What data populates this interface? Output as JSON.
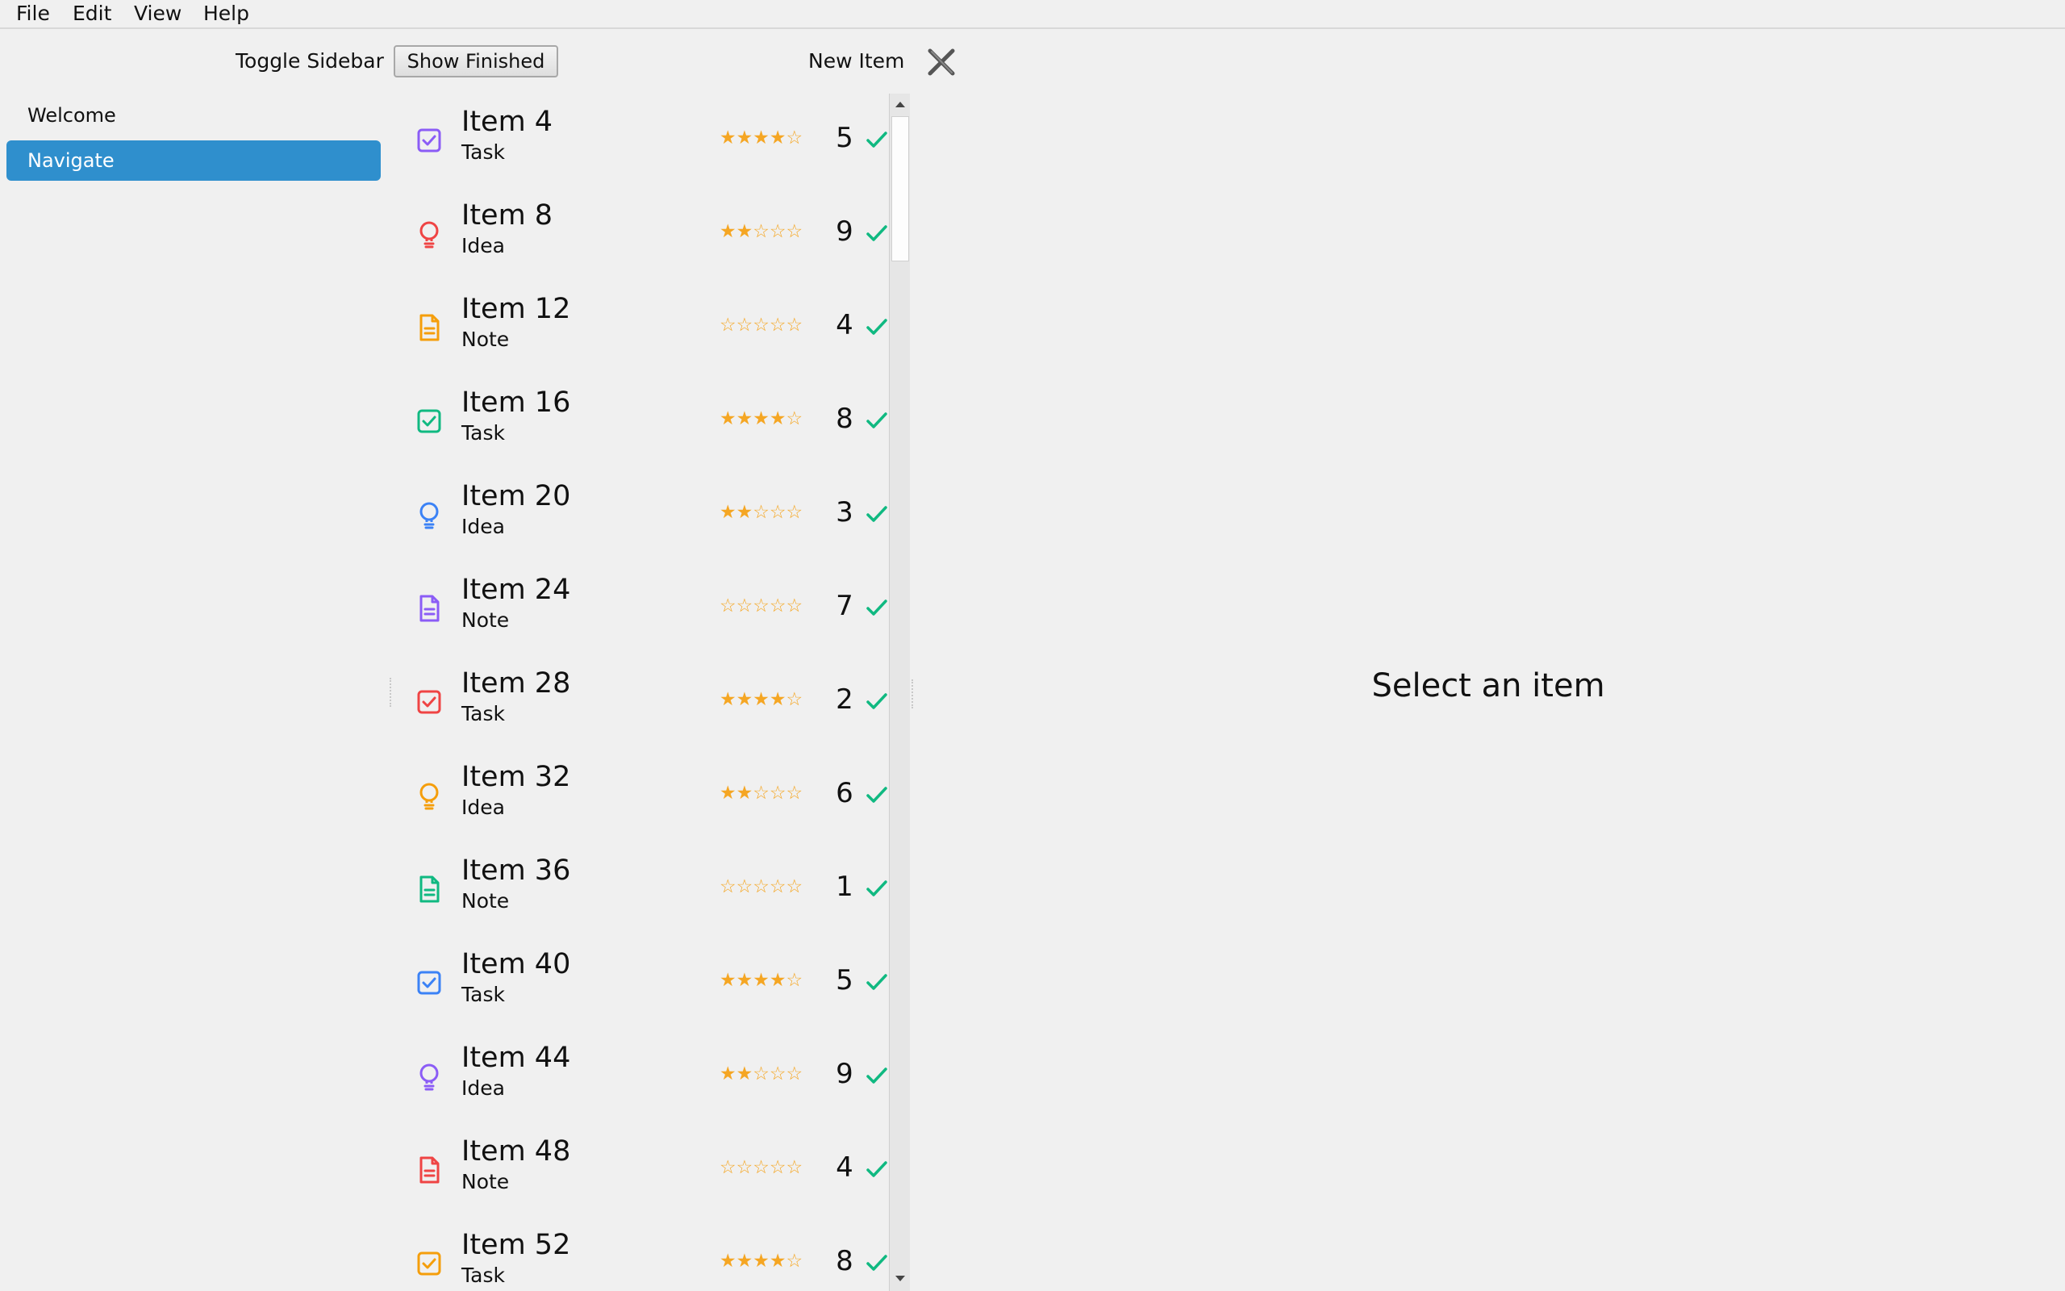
{
  "menu": [
    "File",
    "Edit",
    "View",
    "Help"
  ],
  "toolbar": {
    "toggle_sidebar": "Toggle Sidebar",
    "show_finished": "Show Finished",
    "new_item": "New Item"
  },
  "sidebar": {
    "items": [
      {
        "label": "Welcome",
        "selected": false
      },
      {
        "label": "Navigate",
        "selected": true
      }
    ]
  },
  "list": {
    "items": [
      {
        "title": "Item 4",
        "kind": "Task",
        "icon": "checkbox-icon",
        "color": "#8b5cf6",
        "stars": "★★★★☆",
        "count": "5"
      },
      {
        "title": "Item 8",
        "kind": "Idea",
        "icon": "lightbulb-icon",
        "color": "#ef4444",
        "stars": "★★☆☆☆",
        "count": "9"
      },
      {
        "title": "Item 12",
        "kind": "Note",
        "icon": "document-icon",
        "color": "#f59e0b",
        "stars": "☆☆☆☆☆",
        "count": "4"
      },
      {
        "title": "Item 16",
        "kind": "Task",
        "icon": "checkbox-icon",
        "color": "#10b981",
        "stars": "★★★★☆",
        "count": "8"
      },
      {
        "title": "Item 20",
        "kind": "Idea",
        "icon": "lightbulb-icon",
        "color": "#3b82f6",
        "stars": "★★☆☆☆",
        "count": "3"
      },
      {
        "title": "Item 24",
        "kind": "Note",
        "icon": "document-icon",
        "color": "#8b5cf6",
        "stars": "☆☆☆☆☆",
        "count": "7"
      },
      {
        "title": "Item 28",
        "kind": "Task",
        "icon": "checkbox-icon",
        "color": "#ef4444",
        "stars": "★★★★☆",
        "count": "2"
      },
      {
        "title": "Item 32",
        "kind": "Idea",
        "icon": "lightbulb-icon",
        "color": "#f59e0b",
        "stars": "★★☆☆☆",
        "count": "6"
      },
      {
        "title": "Item 36",
        "kind": "Note",
        "icon": "document-icon",
        "color": "#10b981",
        "stars": "☆☆☆☆☆",
        "count": "1"
      },
      {
        "title": "Item 40",
        "kind": "Task",
        "icon": "checkbox-icon",
        "color": "#3b82f6",
        "stars": "★★★★☆",
        "count": "5"
      },
      {
        "title": "Item 44",
        "kind": "Idea",
        "icon": "lightbulb-icon",
        "color": "#8b5cf6",
        "stars": "★★☆☆☆",
        "count": "9"
      },
      {
        "title": "Item 48",
        "kind": "Note",
        "icon": "document-icon",
        "color": "#ef4444",
        "stars": "☆☆☆☆☆",
        "count": "4"
      },
      {
        "title": "Item 52",
        "kind": "Task",
        "icon": "checkbox-icon",
        "color": "#f59e0b",
        "stars": "★★★★☆",
        "count": "8"
      }
    ],
    "check_color": "#10b981"
  },
  "detail": {
    "placeholder": "Select an item"
  }
}
